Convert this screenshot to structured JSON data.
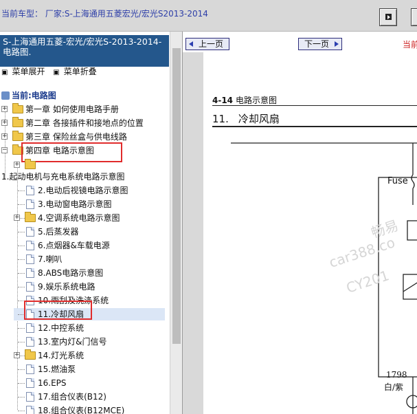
{
  "topbar": {
    "vehicle_text": "当前车型：  厂家:S-上海通用五菱宏光/宏光S2013-2014",
    "buttons": [
      {
        "icon": "play-arrow-icon"
      },
      {
        "icon": "window-icon"
      }
    ]
  },
  "left_panel": {
    "title": "S-上海通用五菱-宏光/宏光S-2013-2014- 电路图.",
    "menu_expand": "菜单展开",
    "menu_collapse": "菜单折叠",
    "current_label": "当前:电路图",
    "tree": {
      "chapters": [
        {
          "label": "第一章 如何使用电路手册"
        },
        {
          "label": "第二章 各接插件和接地点的位置"
        },
        {
          "label": "第三章 保险丝盒与供电线路"
        },
        {
          "label": "第四章 电路示意图",
          "highlighted": true
        }
      ],
      "section_1": "1.起动电机与充电系统电路示意图",
      "items": [
        {
          "label": "2.电动后视镜电路示意图",
          "type": "doc"
        },
        {
          "label": "3.电动窗电路示意图",
          "type": "doc"
        },
        {
          "label": "4.空调系统电路示意图",
          "type": "folder"
        },
        {
          "label": "5.后蒸发器",
          "type": "doc"
        },
        {
          "label": "6.点烟器&车载电源",
          "type": "doc"
        },
        {
          "label": "7.喇叭",
          "type": "doc"
        },
        {
          "label": "8.ABS电路示意图",
          "type": "doc"
        },
        {
          "label": "9.娱乐系统电路",
          "type": "doc"
        },
        {
          "label": "10.雨刮及洗涤系统",
          "type": "doc"
        },
        {
          "label": "11.冷却风扇",
          "type": "doc",
          "selected": true,
          "highlighted": true
        },
        {
          "label": "12.中控系统",
          "type": "doc"
        },
        {
          "label": "13.室内灯&门信号",
          "type": "doc"
        },
        {
          "label": "14.灯光系统",
          "type": "folder"
        },
        {
          "label": "15.燃油泵",
          "type": "doc"
        },
        {
          "label": "16.EPS",
          "type": "doc"
        },
        {
          "label": "17.组合仪表(B12)",
          "type": "doc"
        },
        {
          "label": "18.组合仪表(B12MCE)",
          "type": "doc"
        }
      ]
    }
  },
  "right_panel": {
    "prev_button": "上一页",
    "next_button": "下一页",
    "current_page_label": "当前",
    "document": {
      "section_number": "4-14",
      "section_name": "电路示意图",
      "title_number": "11.",
      "title_text": "冷却风扇",
      "fuse_label": "Fuse",
      "wire_number": "1798",
      "wire_color": "白/紫",
      "watermark_lines": [
        "畅易",
        "car388.co",
        "CY201"
      ]
    }
  },
  "colors": {
    "highlight_border": "#e02b2b",
    "title_bar": "#24578c",
    "topbar_text": "#2d3ea8"
  }
}
